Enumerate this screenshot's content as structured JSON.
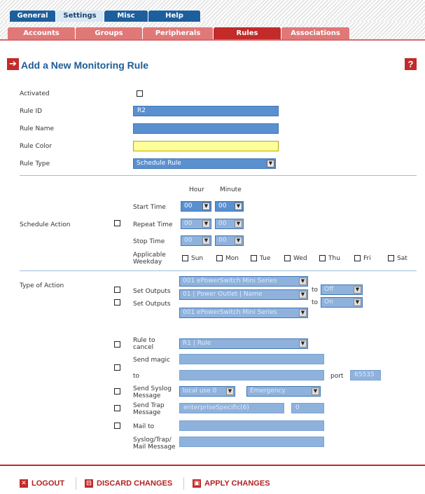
{
  "tabs": [
    "General",
    "Settings",
    "Misc",
    "Help"
  ],
  "subtabs": [
    "Accounts",
    "Groups",
    "Peripherals",
    "Rules",
    "Associations"
  ],
  "page_title": "Add a New Monitoring Rule",
  "form": {
    "activated_label": "Activated",
    "rule_id_label": "Rule ID",
    "rule_id_value": "R2",
    "rule_name_label": "Rule Name",
    "rule_color_label": "Rule Color",
    "rule_type_label": "Rule Type",
    "rule_type_value": "Schedule Rule",
    "hour_label": "Hour",
    "minute_label": "Minute",
    "schedule_action_label": "Schedule Action",
    "start_time_label": "Start Time",
    "repeat_time_label": "Repeat Time",
    "stop_time_label": "Stop Time",
    "weekday_label": "Applicable Weekday",
    "start_hour": "00",
    "start_minute": "00",
    "repeat_hour": "00",
    "repeat_minute": "00",
    "stop_hour": "00",
    "stop_minute": "00",
    "weekdays": [
      "Sun",
      "Mon",
      "Tue",
      "Wed",
      "Thu",
      "Fri",
      "Sat"
    ],
    "type_of_action_label": "Type of Action",
    "set_outputs_label": "Set Outputs",
    "to_label": "to",
    "port_label": "port",
    "rule_to_cancel_label": "Rule to cancel",
    "send_magic_label": "Send magic",
    "send_magic_to_label": "to",
    "send_syslog_label": "Send Syslog Message",
    "send_trap_label": "Send Trap Message",
    "mail_to_label": "Mail to",
    "message_label": "Syslog/Trap/ Mail Message",
    "output1_device": "001 ePowerSwitch Mini Series",
    "output1_port": "01 | Power Outlet | Name",
    "output1_state": "Off",
    "output2_device": "001 ePowerSwitch Mini Series",
    "output2_port": "01 | Power Outlet | Name",
    "output2_state": "On",
    "cancel_rule": "R1 | Rule",
    "magic_port": "65535",
    "syslog_facility": "local use 0",
    "syslog_severity": "Emergency",
    "trap_oid": "enterpriseSpecific(6)",
    "trap_num": "0"
  },
  "footer": {
    "logout": "LOGOUT",
    "discard": "DISCARD CHANGES",
    "apply": "APPLY CHANGES"
  },
  "colors": {
    "accent": "#c32a2a",
    "field": "#5a90cf",
    "tab": "#1d5f9d",
    "yellow": "#ffff99"
  }
}
